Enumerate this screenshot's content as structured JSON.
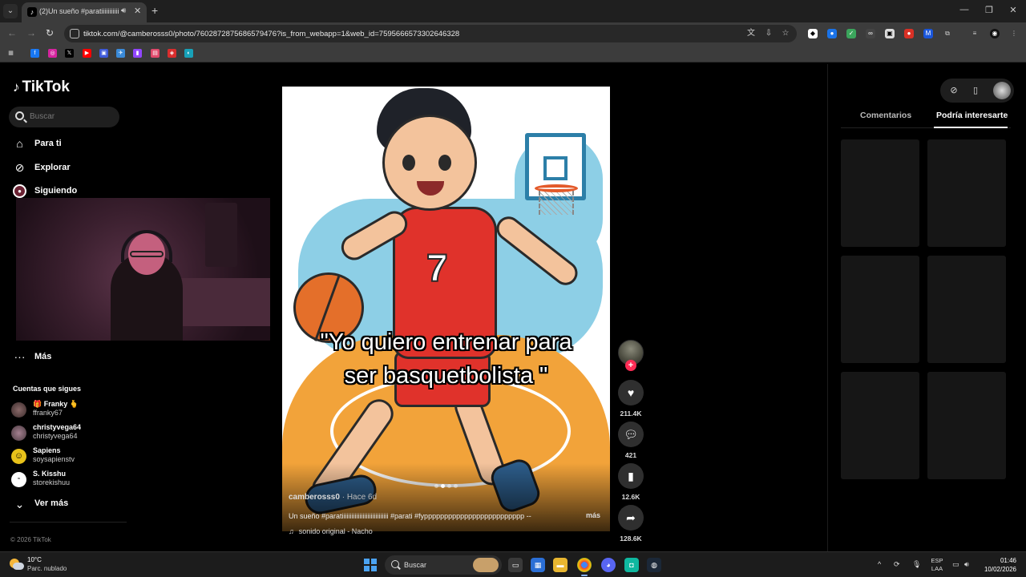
{
  "browser": {
    "tab_title": "(2)Un sueño #paratiiiiiiiiiiii",
    "url": "tiktok.com/@camberosss0/photo/7602872875686579476?is_from_webapp=1&web_id=7595666573302646328"
  },
  "sidebar": {
    "logo": "TikTok",
    "search_placeholder": "Buscar",
    "nav": [
      {
        "label": "Para ti",
        "icon": "home-icon"
      },
      {
        "label": "Explorar",
        "icon": "compass-icon"
      },
      {
        "label": "Siguiendo",
        "icon": "following-icon"
      }
    ],
    "more_label": "Más",
    "following_title": "Cuentas que sigues",
    "accounts": [
      {
        "name": "🎁 Franky 🫰",
        "username": "ffranky67",
        "avatar_color": "#6b4b4b"
      },
      {
        "name": "christyvega64",
        "username": "christyvega64",
        "avatar_color": "#7a5a66"
      },
      {
        "name": "Sapiens",
        "username": "soysapienstv",
        "avatar_color": "#e8c21a"
      },
      {
        "name": "S. Kisshu",
        "username": "storekishuu",
        "avatar_color": "#ffffff"
      }
    ],
    "see_more_label": "Ver más",
    "copyright": "© 2026 TikTok"
  },
  "post": {
    "caption_line1": "\"Yo quiero entrenar para",
    "caption_line2": "ser basquetbolista \"",
    "jersey_number": "7",
    "author": "camberosss0",
    "date": " · Hace 6d",
    "description": "Un sueño #paratiiiiiiiiiiiiiiiiiiiiiiiiiiiii #parati #fyppppppppppppppppppppppppp --",
    "more_label": "más",
    "sound": "sonido original - Nacho",
    "slide_count": 4,
    "active_slide": 1
  },
  "actions": {
    "likes": "211.4K",
    "comments": "421",
    "saves": "12.6K",
    "shares": "128.6K"
  },
  "right_panel": {
    "tabs": [
      "Comentarios",
      "Podría interesarte"
    ],
    "active_tab": "Podría interesarte"
  },
  "taskbar": {
    "temperature": "10°C",
    "weather": "Parc. nublado",
    "search_label": "Buscar",
    "lang_1": "ESP",
    "lang_2": "LAA",
    "time": "01:46",
    "date": "10/02/2026"
  },
  "colors": {
    "accent": "#fe2c55",
    "background": "#000000"
  }
}
